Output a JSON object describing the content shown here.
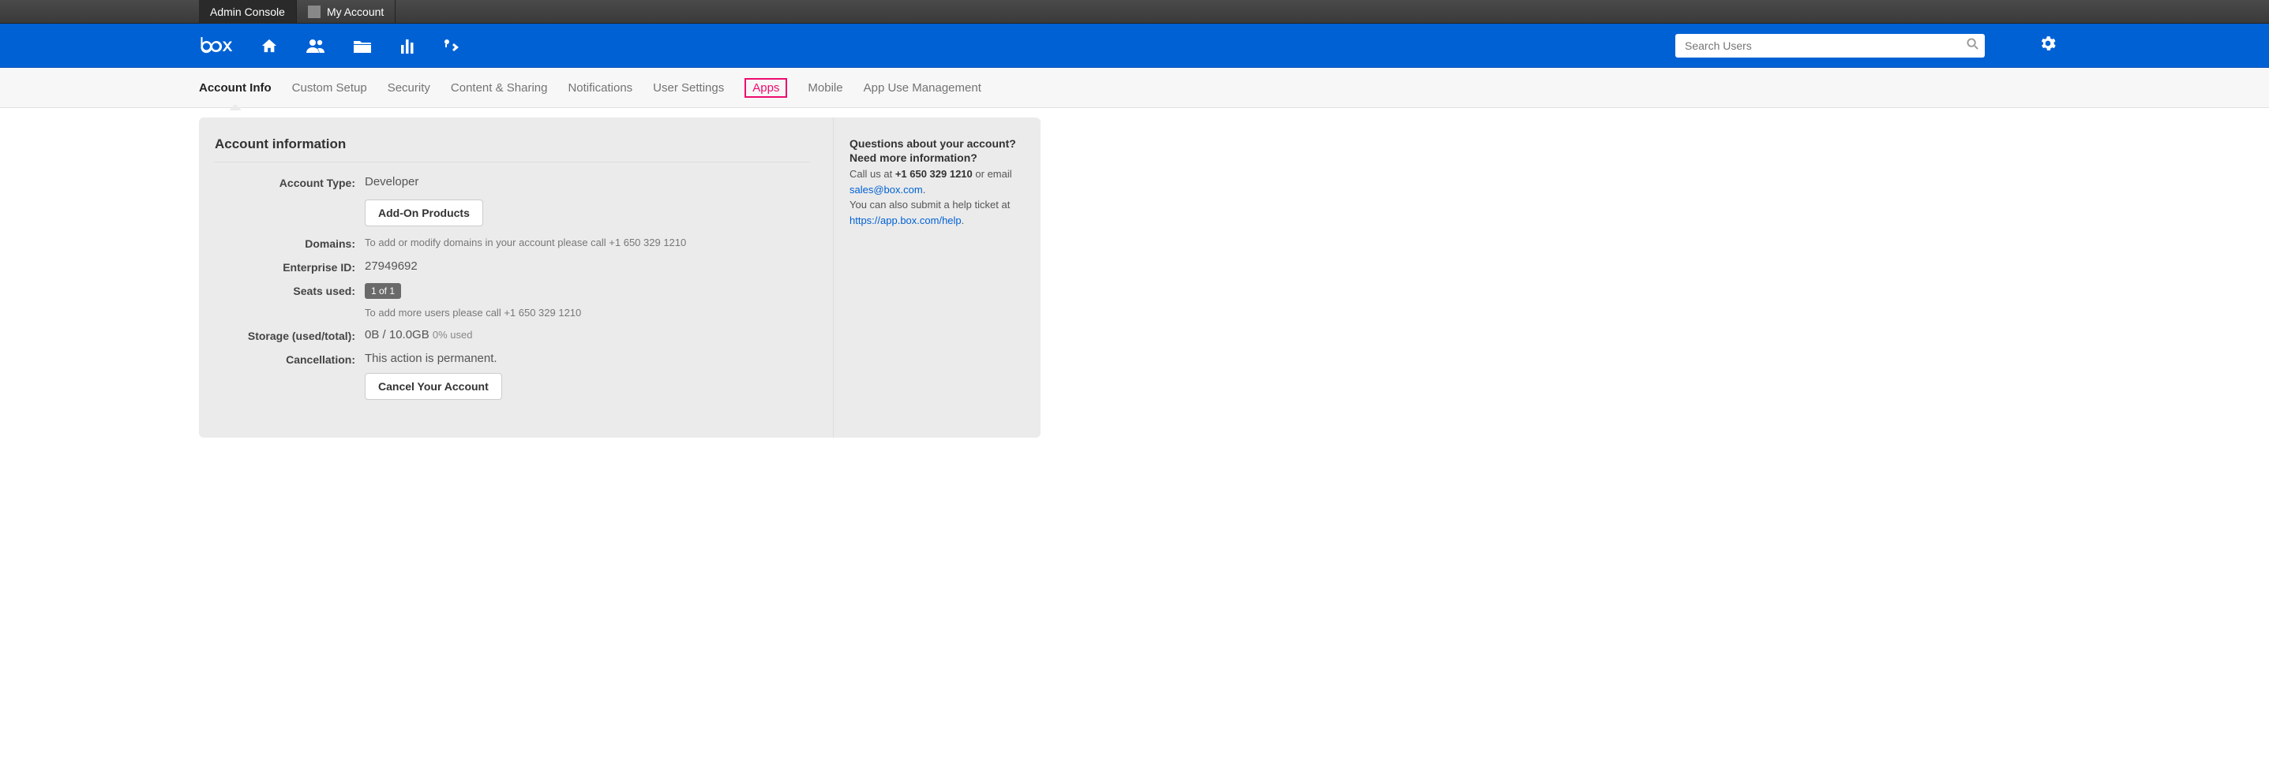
{
  "topbar": {
    "admin_console": "Admin Console",
    "my_account": "My Account"
  },
  "search": {
    "placeholder": "Search Users"
  },
  "subnav": {
    "account_info": "Account Info",
    "custom_setup": "Custom Setup",
    "security": "Security",
    "content_sharing": "Content & Sharing",
    "notifications": "Notifications",
    "user_settings": "User Settings",
    "apps": "Apps",
    "mobile": "Mobile",
    "app_use": "App Use Management"
  },
  "main": {
    "section_title": "Account information",
    "account_type_label": "Account Type:",
    "account_type_value": "Developer",
    "addon_button": "Add-On Products",
    "domains_label": "Domains:",
    "domains_value": "To add or modify domains in your account please call +1 650 329 1210",
    "enterprise_id_label": "Enterprise ID:",
    "enterprise_id_value": "27949692",
    "seats_label": "Seats used:",
    "seats_badge": "1 of 1",
    "seats_hint": "To add more users please call +1 650 329 1210",
    "storage_label": "Storage (used/total):",
    "storage_value": "0B / 10.0GB",
    "storage_pct": "0% used",
    "cancel_label": "Cancellation:",
    "cancel_desc": "This action is permanent.",
    "cancel_button": "Cancel Your Account"
  },
  "side": {
    "title": "Questions about your account? Need more information?",
    "call_prefix": "Call us at ",
    "phone": "+1 650 329 1210",
    "or_email": " or email ",
    "email": "sales@box.com",
    "ticket_prefix": "You can also submit a help ticket at ",
    "help_link": "https://app.box.com/help",
    "period": "."
  }
}
